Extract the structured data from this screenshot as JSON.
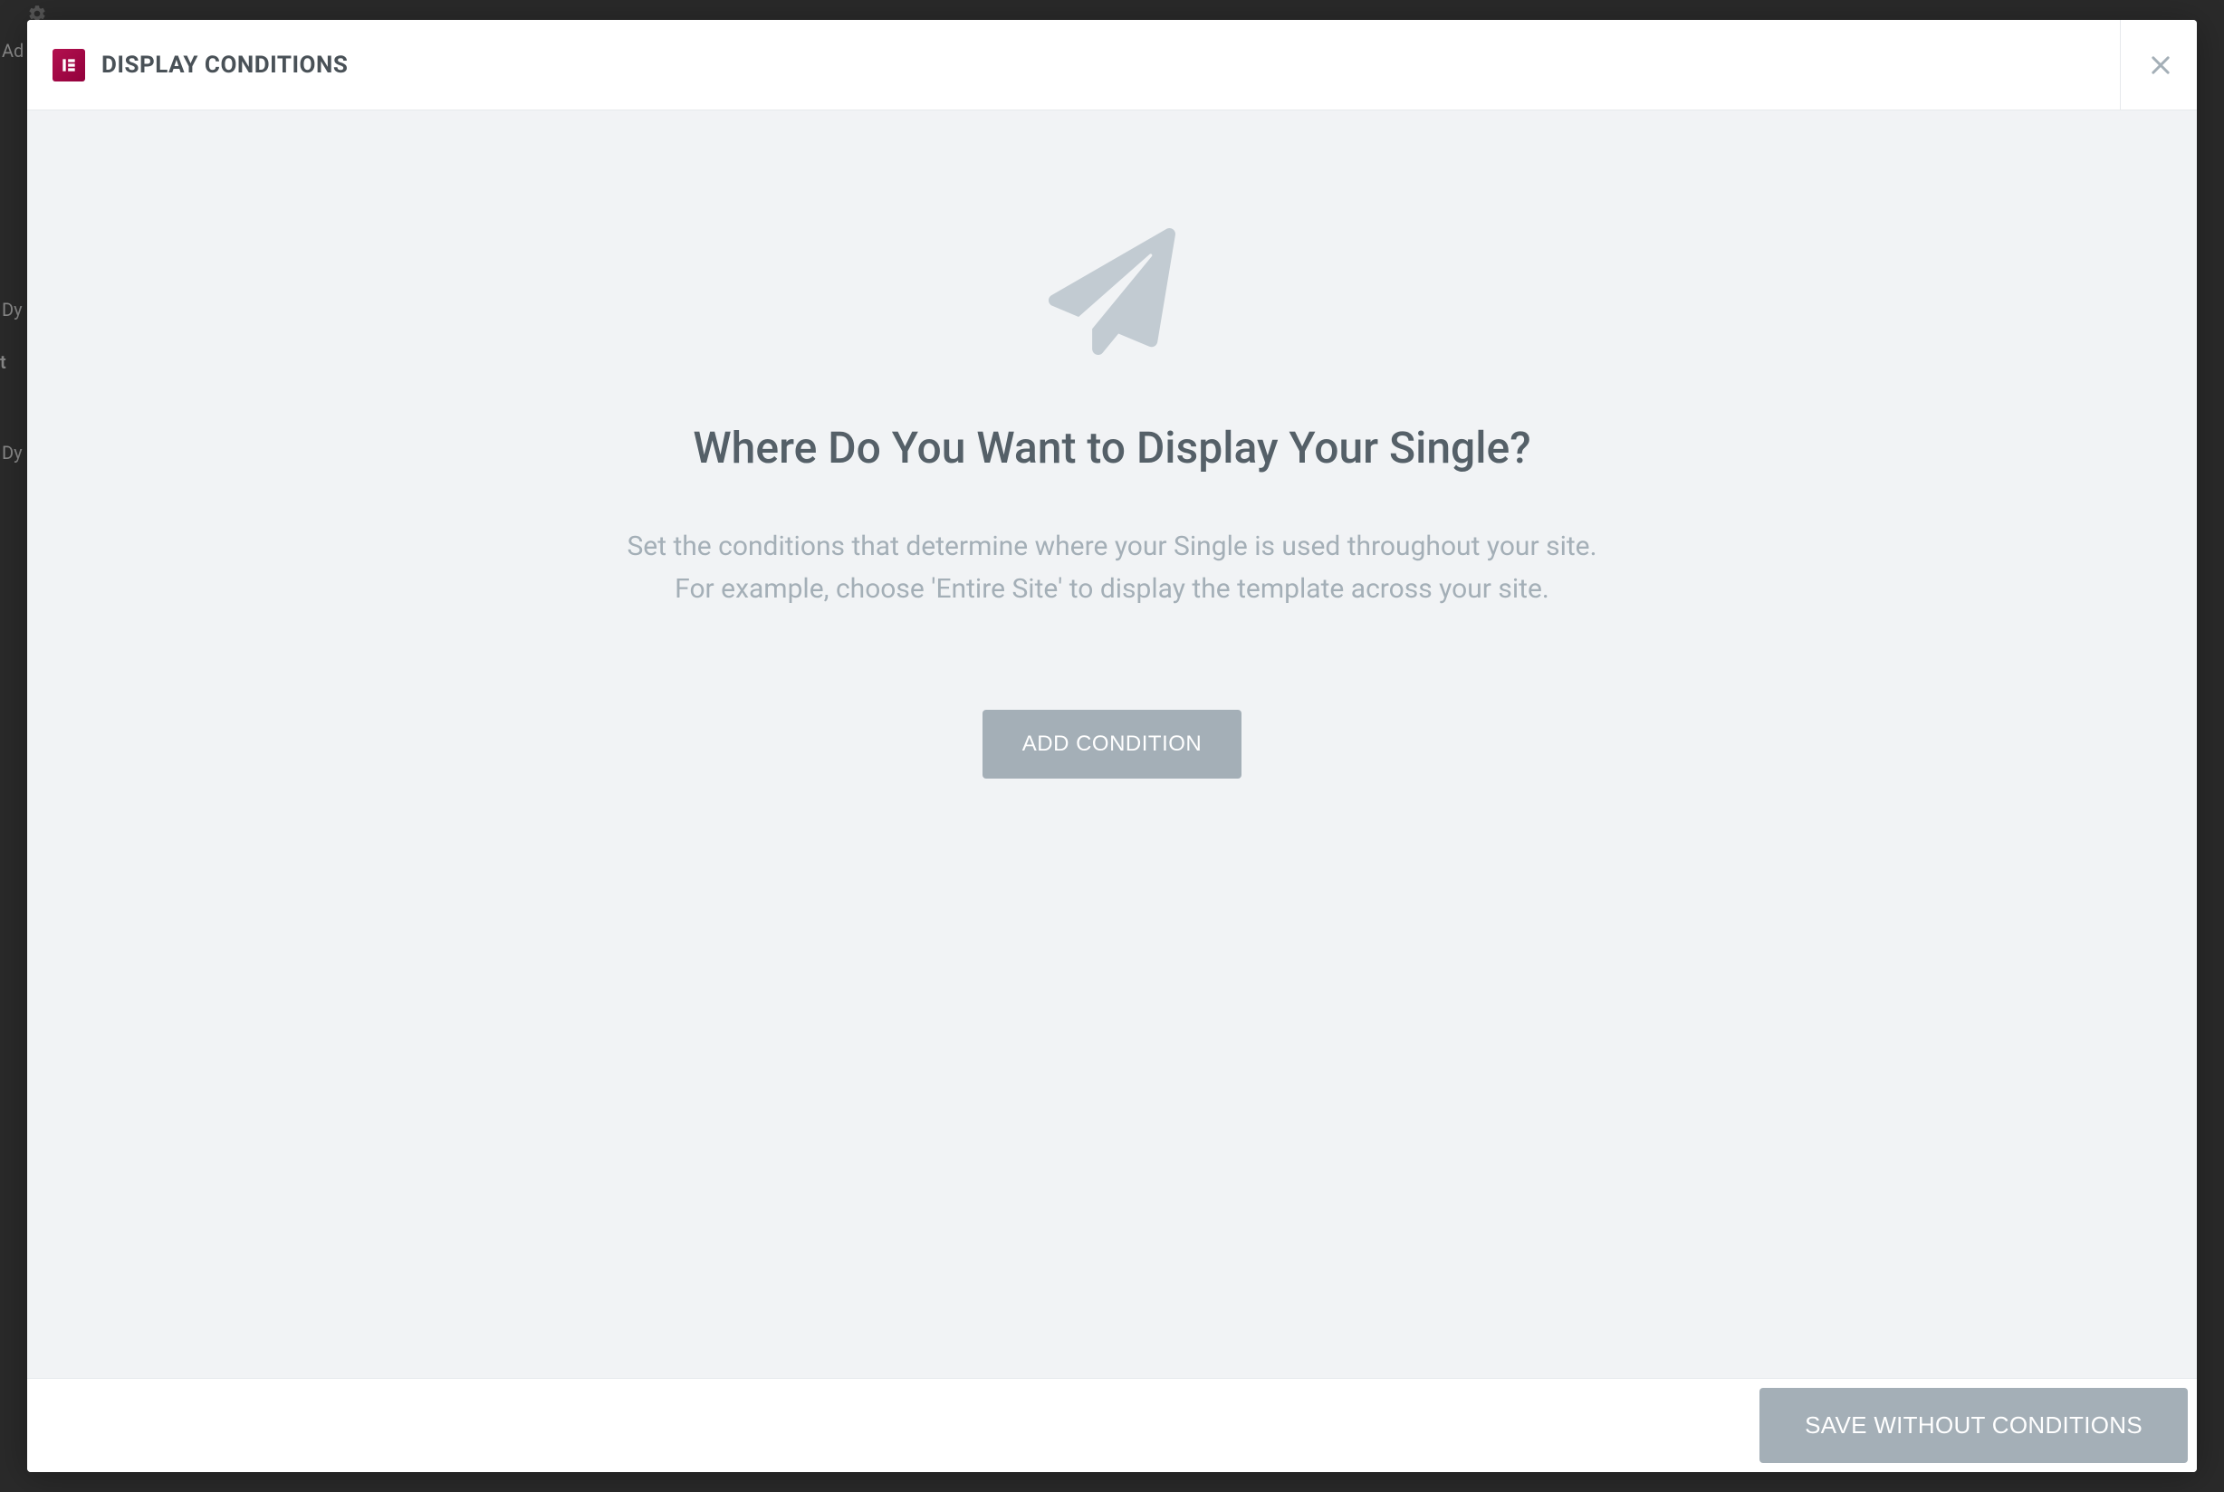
{
  "header": {
    "title": "DISPLAY CONDITIONS"
  },
  "body": {
    "heading": "Where Do You Want to Display Your Single?",
    "description_line1": "Set the conditions that determine where your Single is used throughout your site.",
    "description_line2": "For example, choose 'Entire Site' to display the template across your site.",
    "add_condition_label": "ADD CONDITION"
  },
  "footer": {
    "save_label": "SAVE WITHOUT CONDITIONS"
  },
  "background": {
    "left_text_1": "Ad",
    "left_text_2": "Dy",
    "left_text_3": "t",
    "left_text_4": "Dy"
  }
}
